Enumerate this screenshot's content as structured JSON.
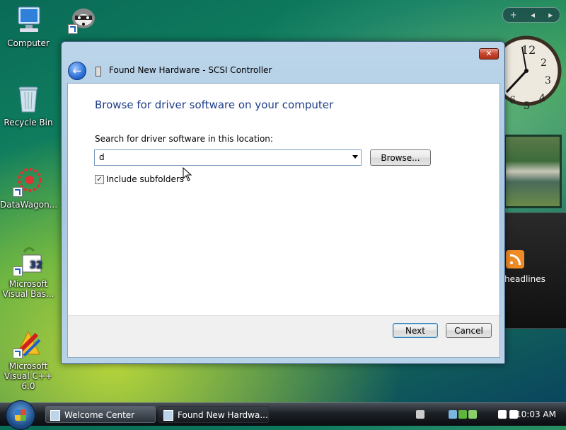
{
  "desktop": {
    "icons": [
      {
        "label": "Computer"
      },
      {
        "label": "Recycle Bin"
      },
      {
        "label": "DataWagon..."
      },
      {
        "label": "Microsoft Visual Bas..."
      },
      {
        "label": "Microsoft Visual C++ 6.0"
      }
    ]
  },
  "gadgets": {
    "controls": {
      "add": "+",
      "prev": "◂",
      "next": "▸"
    },
    "feed_label": "headlines"
  },
  "dialog": {
    "title": "Found New Hardware - SCSI Controller",
    "heading": "Browse for driver software on your computer",
    "search_label": "Search for driver software in this location:",
    "path_value": "d",
    "browse_label": "Browse...",
    "include_subfolders_label": "Include subfolders",
    "include_subfolders_checked": true,
    "next_label": "Next",
    "cancel_label": "Cancel"
  },
  "taskbar": {
    "items": [
      {
        "label": "Welcome Center"
      },
      {
        "label": "Found New Hardwa..."
      }
    ],
    "clock": "10:03 AM"
  },
  "colors": {
    "heading": "#1f3e87",
    "window_frame": "#bcd5ea",
    "close_button": "#c8452d"
  }
}
